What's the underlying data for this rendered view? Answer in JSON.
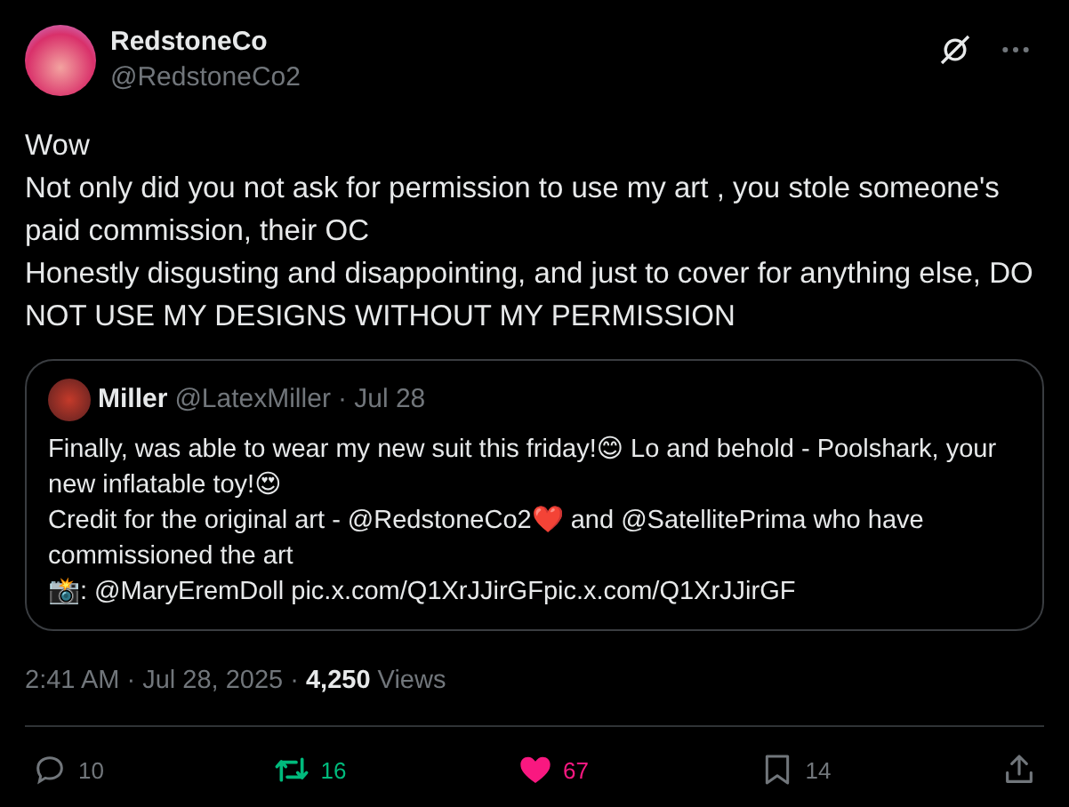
{
  "post": {
    "display_name": "RedstoneCo",
    "handle": "@RedstoneCo2",
    "paragraphs": [
      "Wow",
      "Not only did you not ask for permission to use my art , you stole someone's paid commission, their OC",
      "Honestly disgusting and disappointing, and just to cover for anything else, DO NOT USE MY DESIGNS WITHOUT MY PERMISSION"
    ],
    "quote": {
      "display_name": "Miller",
      "handle": "@LatexMiller",
      "date": "· Jul 28",
      "paragraphs": [
        "Finally, was able to wear my new suit this friday!😊 Lo and behold - Poolshark, your new inflatable toy!😍",
        "Credit for the original art - @RedstoneCo2❤️ and @SatellitePrima who have commissioned the art",
        "📸: @MaryEremDoll pic.x.com/Q1XrJJirGFpic.x.com/Q1XrJJirGF"
      ]
    },
    "time": "2:41 AM · Jul 28, 2025 · ",
    "views_count": "4,250",
    "views_label": "Views",
    "actions": [
      {
        "kind": "reply",
        "count": "10",
        "active": false
      },
      {
        "kind": "repost",
        "count": "16",
        "active": true
      },
      {
        "kind": "like",
        "count": "67",
        "active": true
      },
      {
        "kind": "bookmark",
        "count": "14",
        "active": false
      },
      {
        "kind": "share",
        "active": false
      }
    ]
  }
}
